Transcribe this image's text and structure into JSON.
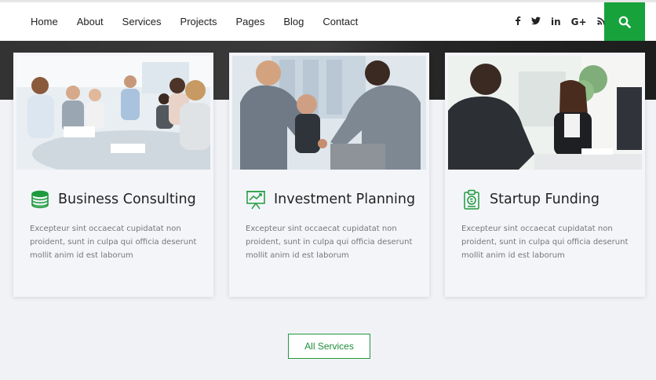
{
  "nav": {
    "items": [
      "Home",
      "About",
      "Services",
      "Projects",
      "Pages",
      "Blog",
      "Contact"
    ]
  },
  "social": {
    "facebook": "f",
    "twitter": "🐦",
    "linkedin": "in",
    "googleplus": "G+",
    "rss": "rss"
  },
  "cards": [
    {
      "title": "Business Consulting",
      "description": "Excepteur sint occaecat cupidatat non proident, sunt in culpa qui officia deserunt mollit anim id est laborum",
      "icon": "coins-icon"
    },
    {
      "title": "Investment Planning",
      "description": "Excepteur sint occaecat cupidatat non proident, sunt in culpa qui officia deserunt mollit anim id est laborum",
      "icon": "presentation-chart-icon"
    },
    {
      "title": "Startup Funding",
      "description": "Excepteur sint occaecat cupidatat non proident, sunt in culpa qui officia deserunt mollit anim id est laborum",
      "icon": "clipboard-funding-icon"
    }
  ],
  "all_services": "All Services",
  "colors": {
    "accent": "#17a23c",
    "text": "#222222"
  }
}
